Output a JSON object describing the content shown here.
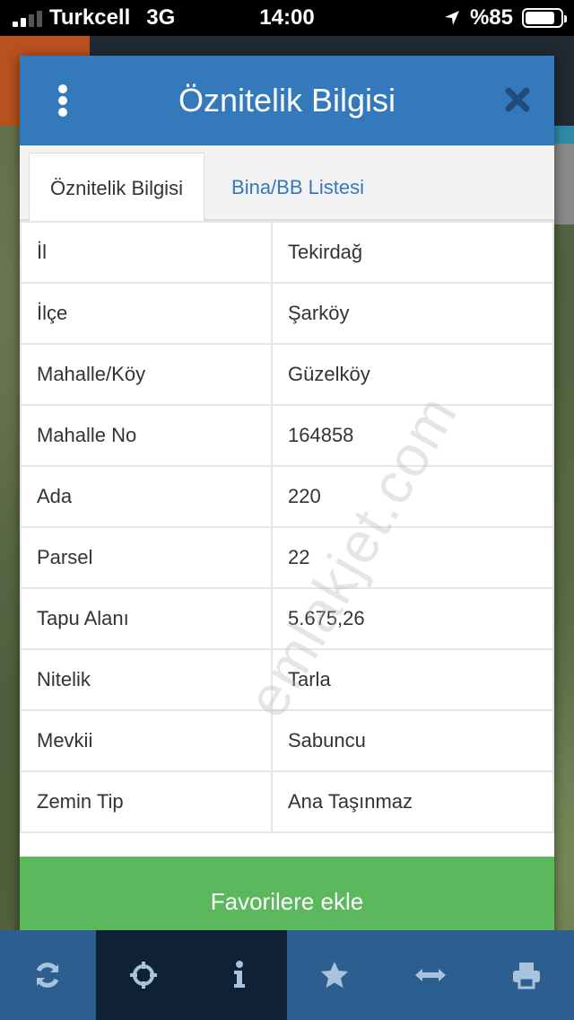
{
  "status_bar": {
    "carrier": "Turkcell",
    "network": "3G",
    "time": "14:00",
    "battery": "%85",
    "battery_level": 0.85
  },
  "modal": {
    "title": "Öznitelik Bilgisi",
    "tabs": [
      {
        "label": "Öznitelik Bilgisi",
        "active": true
      },
      {
        "label": "Bina/BB Listesi",
        "active": false
      }
    ],
    "rows": [
      {
        "label": "İl",
        "value": "Tekirdağ"
      },
      {
        "label": "İlçe",
        "value": "Şarköy"
      },
      {
        "label": "Mahalle/Köy",
        "value": "Güzelköy"
      },
      {
        "label": "Mahalle No",
        "value": "164858"
      },
      {
        "label": "Ada",
        "value": "220"
      },
      {
        "label": "Parsel",
        "value": "22"
      },
      {
        "label": "Tapu Alanı",
        "value": "5.675,26"
      },
      {
        "label": "Nitelik",
        "value": "Tarla"
      },
      {
        "label": "Mevkii",
        "value": "Sabuncu"
      },
      {
        "label": "Zemin Tip",
        "value": "Ana Taşınmaz"
      }
    ],
    "favorite_button": "Favorilere ekle",
    "watermark": "emlakjet.com"
  },
  "toolbar": {
    "items": [
      "refresh-icon",
      "crosshair-icon",
      "info-icon",
      "star-icon",
      "measure-icon",
      "print-icon"
    ],
    "selected": [
      1,
      2
    ]
  },
  "colors": {
    "header_blue": "#3579bd",
    "favorite_green": "#5cb85c",
    "toolbar_blue": "#2c5f8f"
  }
}
